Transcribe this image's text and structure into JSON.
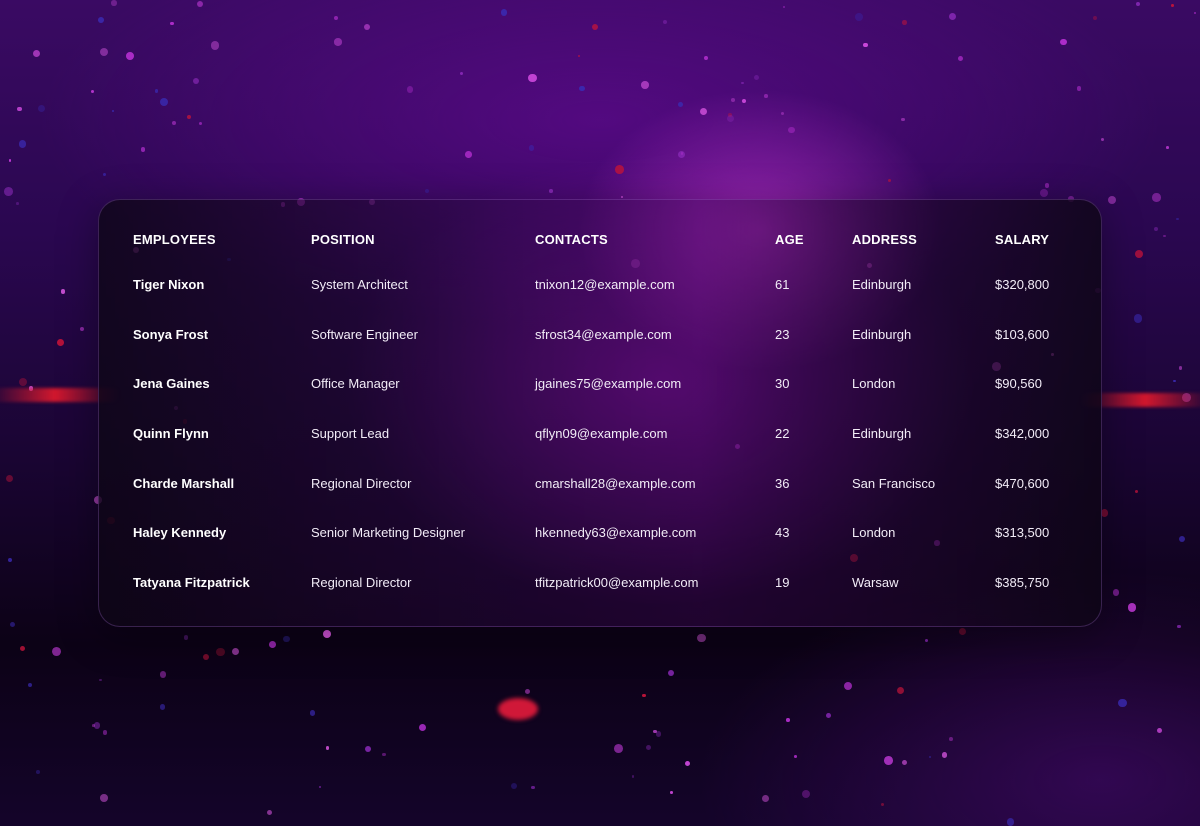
{
  "table": {
    "headers": [
      "EMPLOYEES",
      "POSITION",
      "CONTACTS",
      "AGE",
      "ADDRESS",
      "SALARY"
    ],
    "rows": [
      {
        "name": "Tiger Nixon",
        "position": "System Architect",
        "contact": "tnixon12@example.com",
        "age": "61",
        "address": "Edinburgh",
        "salary": "$320,800"
      },
      {
        "name": "Sonya Frost",
        "position": "Software Engineer",
        "contact": "sfrost34@example.com",
        "age": "23",
        "address": "Edinburgh",
        "salary": "$103,600"
      },
      {
        "name": "Jena Gaines",
        "position": "Office Manager",
        "contact": "jgaines75@example.com",
        "age": "30",
        "address": "London",
        "salary": "$90,560"
      },
      {
        "name": "Quinn Flynn",
        "position": "Support Lead",
        "contact": "qflyn09@example.com",
        "age": "22",
        "address": "Edinburgh",
        "salary": "$342,000"
      },
      {
        "name": "Charde Marshall",
        "position": "Regional Director",
        "contact": "cmarshall28@example.com",
        "age": "36",
        "address": "San Francisco",
        "salary": "$470,600"
      },
      {
        "name": "Haley Kennedy",
        "position": "Senior Marketing Designer",
        "contact": "hkennedy63@example.com",
        "age": "43",
        "address": "London",
        "salary": "$313,500"
      },
      {
        "name": "Tatyana Fitzpatrick",
        "position": "Regional Director",
        "contact": "tfitzpatrick00@example.com",
        "age": "19",
        "address": "Warsaw",
        "salary": "$385,750"
      }
    ]
  },
  "colors": {
    "background_top": "#3a0a63",
    "background_bottom": "#0c0216",
    "glow": "#dc3ce6",
    "streak": "#dc192d",
    "text": "#ffffff"
  }
}
